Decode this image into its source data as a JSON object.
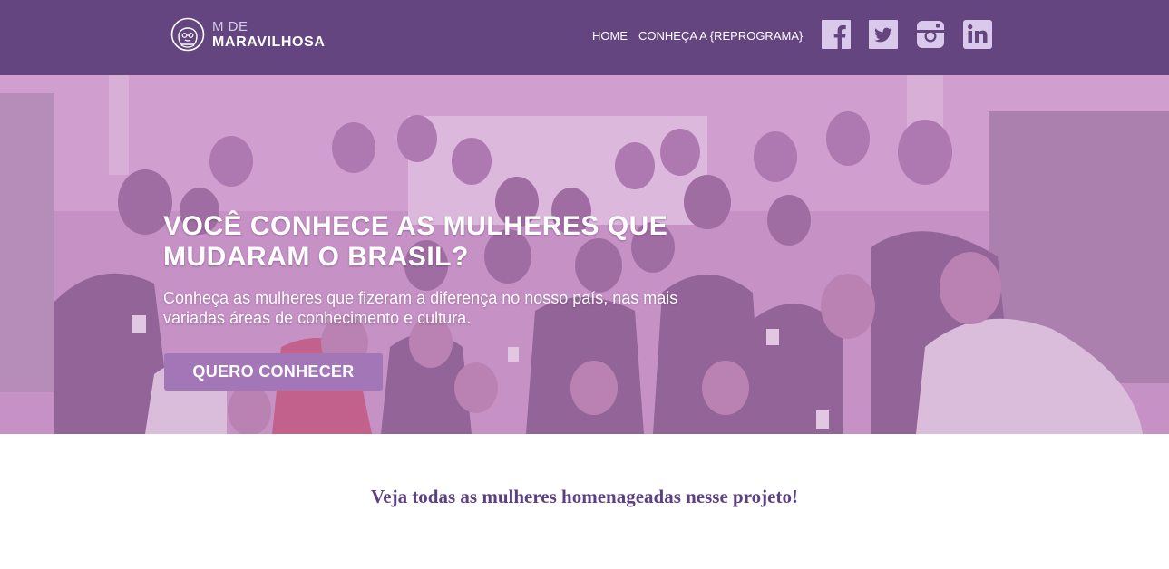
{
  "brand": {
    "line1": "M DE",
    "line2": "MARAVILHOSA"
  },
  "nav": {
    "items": [
      {
        "label": "HOME"
      },
      {
        "label": "CONHEÇA A {REPROGRAMA}"
      }
    ]
  },
  "social": {
    "icons": [
      "facebook-icon",
      "twitter-icon",
      "instagram-icon",
      "linkedin-icon"
    ]
  },
  "hero": {
    "title": "VOCÊ CONHECE AS MULHERES QUE MUDARAM O BRASIL?",
    "subtitle": "Conheça as mulheres que fizeram a diferença no nosso país, nas mais variadas áreas de conhecimento e cultura.",
    "cta_label": "QUERO CONHECER"
  },
  "section": {
    "heading": "Veja todas as mulheres homenageadas nesse projeto!"
  },
  "colors": {
    "header_bg": "#64457f",
    "hero_overlay": "#c794c6",
    "button_bg": "#a376b8",
    "heading_text": "#5d3f86",
    "icon_color": "#d9c9ea"
  }
}
